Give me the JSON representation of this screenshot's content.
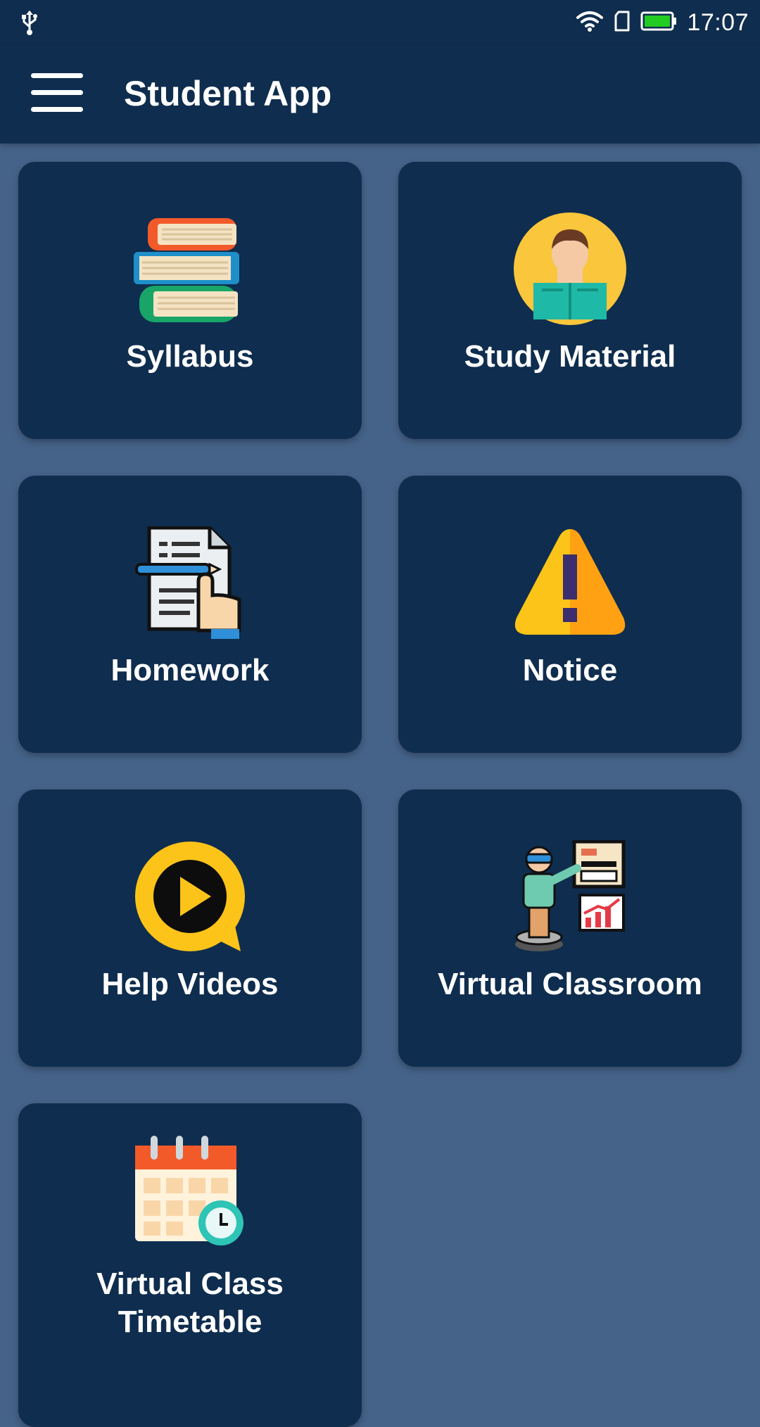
{
  "status_bar": {
    "time": "17:07"
  },
  "app_bar": {
    "title": "Student App"
  },
  "colors": {
    "app_bar": "#0f2d4e",
    "background": "#456389",
    "tile": "#0f2d4e",
    "battery": "#22cc22"
  },
  "tiles": [
    {
      "label": "Syllabus",
      "icon": "books-icon"
    },
    {
      "label": "Study Material",
      "icon": "student-reading-icon"
    },
    {
      "label": "Homework",
      "icon": "homework-document-icon"
    },
    {
      "label": "Notice",
      "icon": "warning-icon"
    },
    {
      "label": "Help Videos",
      "icon": "play-video-icon"
    },
    {
      "label": "Virtual Classroom",
      "icon": "teacher-board-icon"
    },
    {
      "label": "Virtual Class\nTimetable",
      "icon": "calendar-clock-icon"
    }
  ]
}
